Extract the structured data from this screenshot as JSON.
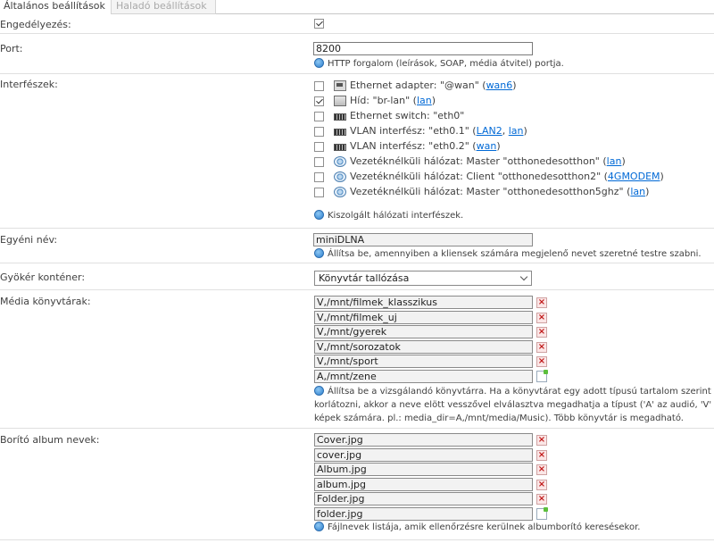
{
  "tabs": [
    {
      "label": "Általános beállítások"
    },
    {
      "label": "Haladó beállítások"
    }
  ],
  "enable": {
    "label": "Engedélyezés:",
    "checked": true
  },
  "port": {
    "label": "Port:",
    "value": "8200",
    "help": "HTTP forgalom (leírások, SOAP, média átvitel) portja."
  },
  "interfaces": {
    "label": "Interfészek:",
    "items": [
      {
        "checked": false,
        "icon": "ethernet-adapter-icon",
        "text": "Ethernet adapter: \"@wan\" (",
        "links": [
          "wan6"
        ],
        "suffix": ")"
      },
      {
        "checked": true,
        "icon": "bridge-icon",
        "text": "Híd: \"br-lan\" (",
        "links": [
          "lan"
        ],
        "suffix": ")"
      },
      {
        "checked": false,
        "icon": "switch-icon",
        "text": "Ethernet switch: \"eth0\"",
        "links": [],
        "suffix": ""
      },
      {
        "checked": false,
        "icon": "switch-icon",
        "text": "VLAN interfész: \"eth0.1\" (",
        "links": [
          "LAN2",
          "lan"
        ],
        "suffix": ")"
      },
      {
        "checked": false,
        "icon": "switch-icon",
        "text": "VLAN interfész: \"eth0.2\" (",
        "links": [
          "wan"
        ],
        "suffix": ")"
      },
      {
        "checked": false,
        "icon": "wifi-icon",
        "text": "Vezetéknélküli hálózat: Master \"otthonedesotthon\" (",
        "links": [
          "lan"
        ],
        "suffix": ")"
      },
      {
        "checked": false,
        "icon": "wifi-icon",
        "text": "Vezetéknélküli hálózat: Client \"otthonedesotthon2\" (",
        "links": [
          "4GMODEM"
        ],
        "suffix": ")"
      },
      {
        "checked": false,
        "icon": "wifi-icon",
        "text": "Vezetéknélküli hálózat: Master \"otthonedesotthon5ghz\" (",
        "links": [
          "lan"
        ],
        "suffix": ")"
      }
    ],
    "help": "Kiszolgált hálózati interfészek."
  },
  "friendly_name": {
    "label": "Egyéni név:",
    "value": "miniDLNA",
    "help": "Állítsa be, amennyiben a kliensek számára megjelenő nevet szeretné testre szabni."
  },
  "root_container": {
    "label": "Gyökér konténer:",
    "selected": "Könyvtár tallózása"
  },
  "media_dirs": {
    "label": "Média könyvtárak:",
    "items": [
      "V,/mnt/filmek_klasszikus",
      "V,/mnt/filmek_uj",
      "V,/mnt/gyerek",
      "V,/mnt/sorozatok",
      "V,/mnt/sport",
      "A,/mnt/zene"
    ],
    "help_lines": [
      "Állítsa be a vizsgálandó könyvtárra. Ha a könyvtárat egy adott típusú tartalom szerint sz",
      "korlátozni, akkor a neve elött vesszővel elválasztva megadhatja a típust ('A' az audió, 'V' a v",
      "képek számára. pl.: media_dir=A,/mnt/media/Music). Több könyvtár is megadható."
    ]
  },
  "album_art": {
    "label": "Borító album nevek:",
    "items": [
      "Cover.jpg",
      "cover.jpg",
      "Album.jpg",
      "album.jpg",
      "Folder.jpg",
      "folder.jpg"
    ],
    "help": "Fájlnevek listája, amik ellenőrzésre kerülnek albumborító keresésekor."
  },
  "colors": {
    "link": "#0069d6",
    "remove": "#c01818",
    "text": "#404040"
  }
}
